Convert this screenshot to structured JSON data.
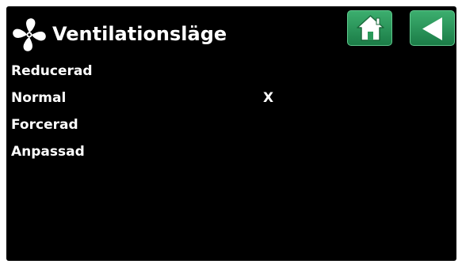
{
  "header": {
    "title": "Ventilationsläge",
    "icon": "fan-icon",
    "home_icon": "home-icon",
    "back_icon": "back-arrow-icon"
  },
  "modes": [
    {
      "label": "Reducerad",
      "mark": ""
    },
    {
      "label": "Normal",
      "mark": "X"
    },
    {
      "label": "Forcerad",
      "mark": ""
    },
    {
      "label": "Anpassad",
      "mark": ""
    }
  ],
  "colors": {
    "background": "#000000",
    "text": "#ffffff",
    "button_green": "#2a9a5a"
  }
}
